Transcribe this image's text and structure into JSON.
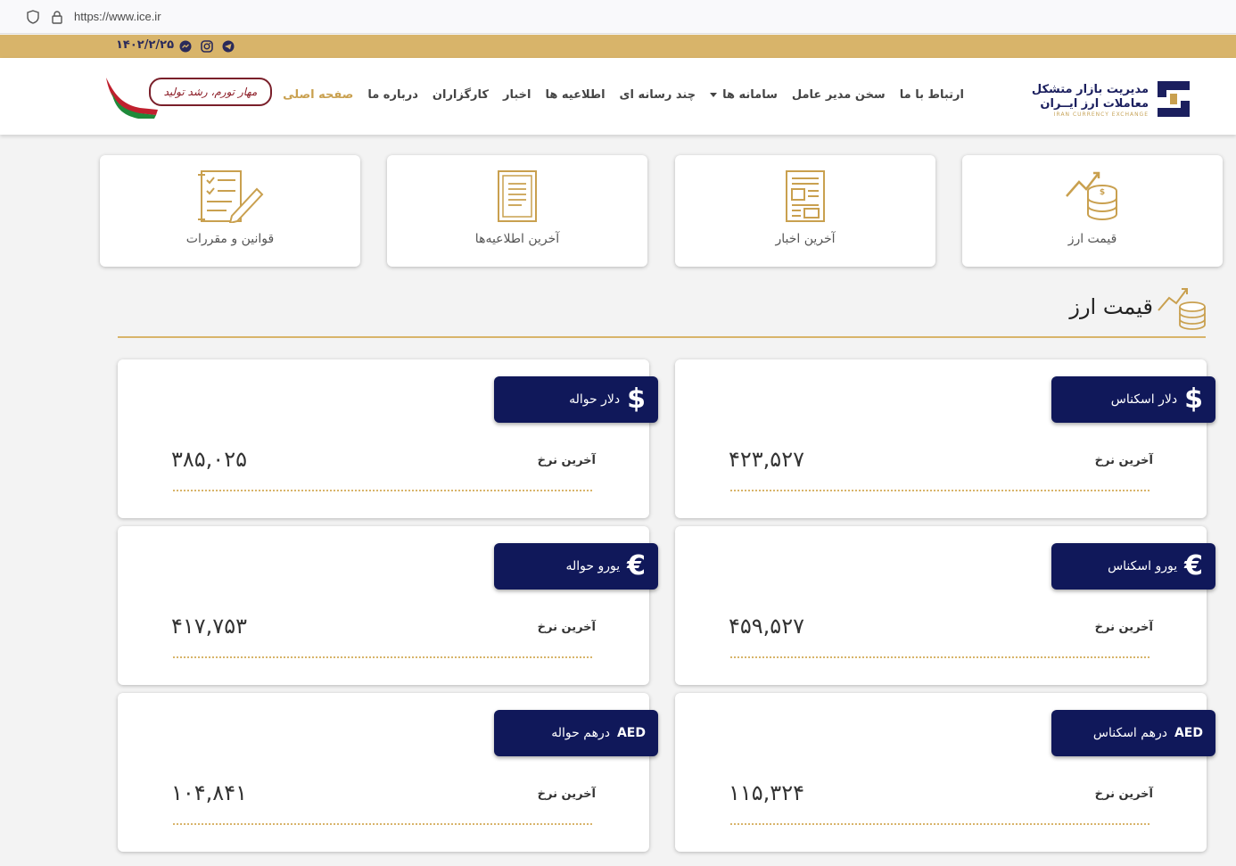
{
  "browser": {
    "url": "https://www.ice.ir"
  },
  "topbar": {
    "date": "۱۴۰۲/۲/۲۵",
    "social_icons": [
      "messenger-icon",
      "instagram-icon",
      "telegram-icon"
    ]
  },
  "brand": {
    "line1": "مدیریت بازار متشکل",
    "line2": "معاملات ارز ایــران",
    "line3": "IRAN CURRENCY EXCHANGE"
  },
  "nav": {
    "items": [
      "صفحه اصلی",
      "درباره ما",
      "کارگزاران",
      "اخبار",
      "اطلاعیه ها",
      "چند رسانه ای",
      "سامانه ها",
      "سخن مدیر عامل",
      "ارتباط با ما"
    ]
  },
  "slogan": {
    "text": "مهار تورم، رشد تولید"
  },
  "quick_cards": [
    {
      "label": "قیمت ارز",
      "icon": "coins-chart-icon"
    },
    {
      "label": "آخرین اخبار",
      "icon": "newspaper-icon"
    },
    {
      "label": "آخرین اطلاعیه‌ها",
      "icon": "document-icon"
    },
    {
      "label": "قوانین و مقررات",
      "icon": "checklist-pen-icon"
    }
  ],
  "section": {
    "title": "قیمت ارز"
  },
  "rates": {
    "label": "آخرین نرخ",
    "cards": [
      {
        "symbol": "$",
        "name": "دلار اسکناس",
        "value": "۴۲۳,۵۲۷"
      },
      {
        "symbol": "$",
        "name": "دلار حواله",
        "value": "۳۸۵,۰۲۵"
      },
      {
        "symbol": "€",
        "name": "یورو اسکناس",
        "value": "۴۵۹,۵۲۷"
      },
      {
        "symbol": "€",
        "name": "یورو حواله",
        "value": "۴۱۷,۷۵۳"
      },
      {
        "symbol": "AED",
        "name": "درهم اسکناس",
        "value": "۱۱۵,۳۲۴"
      },
      {
        "symbol": "AED",
        "name": "درهم حواله",
        "value": "۱۰۴,۸۴۱"
      }
    ]
  },
  "colors": {
    "gold": "#d8b46a",
    "navy": "#10185a",
    "active_nav": "#c9a04f"
  }
}
